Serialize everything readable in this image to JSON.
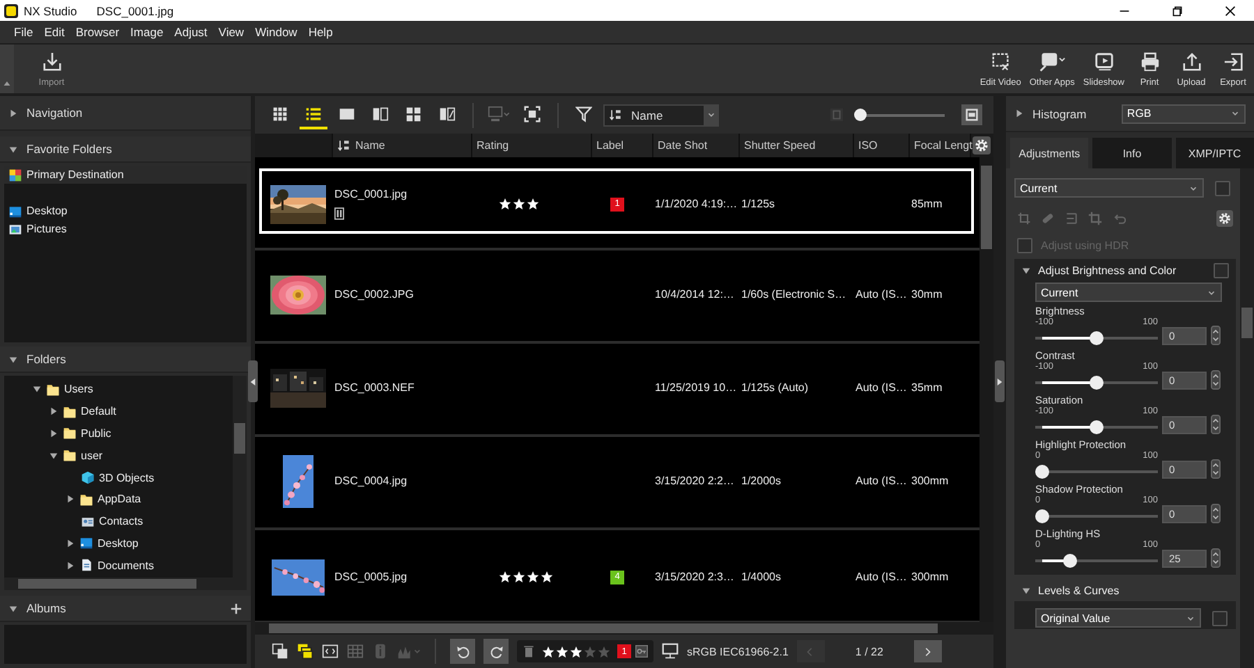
{
  "window": {
    "app_name": "NX Studio",
    "file_name": "DSC_0001.jpg"
  },
  "menu": [
    "File",
    "Edit",
    "Browser",
    "Image",
    "Adjust",
    "View",
    "Window",
    "Help"
  ],
  "toolbar": {
    "import": {
      "label": "Import"
    },
    "actions": [
      {
        "label": "Edit Video",
        "kind": "edit_video"
      },
      {
        "label": "Other Apps",
        "kind": "other_apps"
      },
      {
        "label": "Slideshow",
        "kind": "slideshow"
      },
      {
        "label": "Print",
        "kind": "print"
      },
      {
        "label": "Upload",
        "kind": "upload"
      },
      {
        "label": "Export",
        "kind": "export"
      }
    ]
  },
  "left_panel": {
    "navigation": {
      "title": "Navigation",
      "expanded": false
    },
    "favorites": {
      "title": "Favorite Folders",
      "expanded": true,
      "items": [
        {
          "label": "Primary Destination",
          "kind": "primary",
          "selected": true
        },
        {
          "label": "Desktop",
          "kind": "desktop",
          "selected": false
        },
        {
          "label": "Pictures",
          "kind": "pictures",
          "selected": false
        }
      ]
    },
    "folders": {
      "title": "Folders",
      "expanded": true,
      "tree": [
        {
          "label": "Users",
          "kind": "folder",
          "expanded": true,
          "children": [
            {
              "label": "Default",
              "kind": "folder",
              "expanded": false
            },
            {
              "label": "Public",
              "kind": "folder",
              "expanded": false
            },
            {
              "label": "user",
              "kind": "folder",
              "expanded": true,
              "children": [
                {
                  "label": "3D Objects",
                  "kind": "objects3d"
                },
                {
                  "label": "AppData",
                  "kind": "folder",
                  "expanded": false
                },
                {
                  "label": "Contacts",
                  "kind": "contacts"
                },
                {
                  "label": "Desktop",
                  "kind": "desktop",
                  "expanded": false
                },
                {
                  "label": "Documents",
                  "kind": "documents",
                  "expanded": false
                }
              ]
            }
          ]
        }
      ]
    },
    "albums": {
      "title": "Albums",
      "expanded": true
    }
  },
  "view_toolbar": {
    "views": [
      {
        "kind": "grid",
        "selected": false
      },
      {
        "kind": "list",
        "selected": true
      },
      {
        "kind": "single",
        "selected": false
      },
      {
        "kind": "compare",
        "selected": false
      },
      {
        "kind": "quad",
        "selected": false
      },
      {
        "kind": "before_after",
        "selected": false
      }
    ],
    "sort": {
      "label": "Name"
    },
    "thumbnail_size": {
      "level": 0.05
    }
  },
  "table": {
    "columns": [
      "Name",
      "Rating",
      "Label",
      "Date Shot",
      "Shutter Speed",
      "ISO",
      "Focal Lengt"
    ],
    "rows": [
      {
        "name": "DSC_0001.jpg",
        "selected": true,
        "adjusted": true,
        "stars": 3,
        "label": {
          "text": "1",
          "color": "#e0101c"
        },
        "date_shot": "1/1/2020 4:19:…",
        "shutter_speed": "1/125s",
        "focal_length": "85mm"
      },
      {
        "name": "DSC_0002.JPG",
        "selected": false,
        "adjusted": false,
        "date_shot": "10/4/2014 12:…",
        "shutter_speed": "1/60s (Electronic S…",
        "iso": "Auto (IS…",
        "focal_length": "30mm"
      },
      {
        "name": "DSC_0003.NEF",
        "selected": false,
        "adjusted": false,
        "date_shot": "11/25/2019 10…",
        "shutter_speed": "1/125s (Auto)",
        "iso": "Auto (IS…",
        "focal_length": "35mm"
      },
      {
        "name": "DSC_0004.jpg",
        "selected": false,
        "adjusted": false,
        "date_shot": "3/15/2020 2:2…",
        "shutter_speed": "1/2000s",
        "iso": "Auto (IS…",
        "focal_length": "300mm"
      },
      {
        "name": "DSC_0005.jpg",
        "selected": false,
        "adjusted": false,
        "stars": 4,
        "label": {
          "text": "4",
          "color": "#6ac21c"
        },
        "date_shot": "3/15/2020 2:3…",
        "shutter_speed": "1/4000s",
        "iso": "Auto (IS…",
        "focal_length": "300mm"
      }
    ]
  },
  "bottom_bar": {
    "rating": {
      "stars": 3
    },
    "label": {
      "text": "1",
      "color": "#e0101c"
    },
    "color_profile": "sRGB IEC61966-2.1",
    "page": "1 / 22"
  },
  "right_panel": {
    "histogram": {
      "title": "Histogram",
      "expanded": false,
      "channel": "RGB"
    },
    "tabs": [
      {
        "label": "Adjustments",
        "selected": true
      },
      {
        "label": "Info",
        "selected": false
      },
      {
        "label": "XMP/IPTC",
        "selected": false
      }
    ],
    "preset": {
      "value": "Current",
      "checked": false
    },
    "hdr": {
      "label": "Adjust using HDR",
      "checked": false,
      "disabled": true
    },
    "sections": [
      {
        "title": "Adjust Brightness and Color",
        "expanded": true,
        "checked": false,
        "preset": "Current",
        "sliders": [
          {
            "label": "Brightness",
            "min": "-100",
            "max": "100",
            "level": 0.5,
            "value": "0"
          },
          {
            "label": "Contrast",
            "min": "-100",
            "max": "100",
            "level": 0.5,
            "value": "0"
          },
          {
            "label": "Saturation",
            "min": "-100",
            "max": "100",
            "level": 0.5,
            "value": "0"
          },
          {
            "label": "Highlight Protection",
            "min": "0",
            "max": "100",
            "level": 0,
            "value": "0"
          },
          {
            "label": "Shadow Protection",
            "min": "0",
            "max": "100",
            "level": 0,
            "value": "0"
          },
          {
            "label": "D-Lighting HS",
            "min": "0",
            "max": "100",
            "level": 0.25,
            "value": "25"
          }
        ]
      },
      {
        "title": "Levels & Curves",
        "expanded": true,
        "checked": false,
        "preset": "Original Value"
      }
    ]
  }
}
